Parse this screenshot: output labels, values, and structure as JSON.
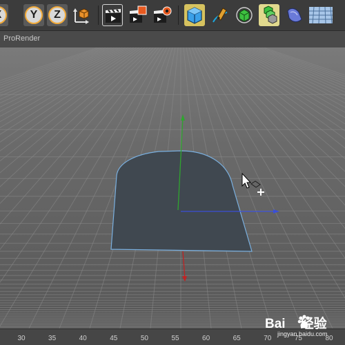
{
  "toolbar": {
    "axis_x": "X",
    "axis_y": "Y",
    "axis_z": "Z"
  },
  "viewport": {
    "renderer_label": "ProRender"
  },
  "timeline": {
    "ticks": [
      "30",
      "35",
      "40",
      "45",
      "50",
      "55",
      "60",
      "65",
      "70",
      "75",
      "80"
    ]
  },
  "watermark": {
    "brand": "Bai度经验",
    "url": "jingyan.baidu.com"
  },
  "colors": {
    "accent_orange": "#f1aa3a",
    "object_fill": "#404850",
    "selection_outline": "#7ab0e0",
    "axis_x": "#3a4fd8",
    "axis_y": "#2fa52f",
    "axis_z": "#c02424"
  }
}
